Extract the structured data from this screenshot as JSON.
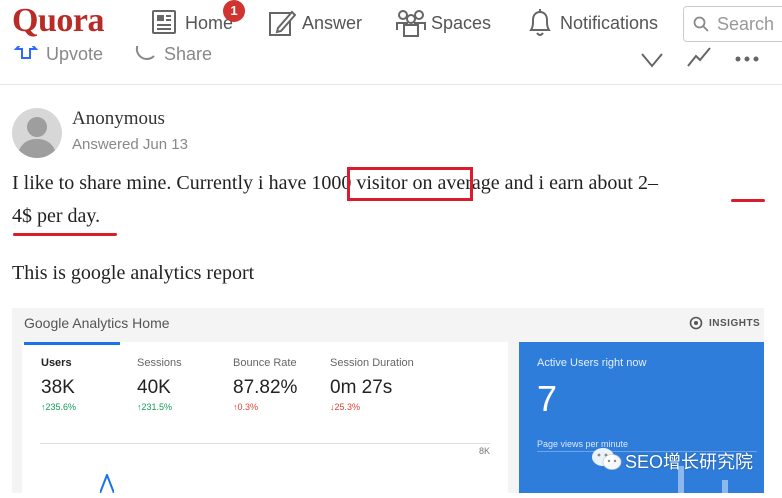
{
  "header": {
    "logo": "Quora",
    "nav": [
      {
        "label": "Home",
        "icon": "home-feed-icon"
      },
      {
        "label": "Answer",
        "icon": "pencil-icon"
      },
      {
        "label": "Spaces",
        "icon": "people-icon"
      },
      {
        "label": "Notifications",
        "icon": "bell-icon"
      }
    ],
    "home_badge": "1",
    "search_placeholder": "Search"
  },
  "action_bar": {
    "upvote": "Upvote",
    "share": "Share"
  },
  "answer": {
    "author": "Anonymous",
    "date": "Answered Jun 13",
    "line1_a": "I like to share mine. Currently i have",
    "line1_highlight": "1000 visitor",
    "line1_b": "on average and i earn about",
    "line1_c": "2–",
    "line2": "4$ per day.",
    "para2": "This is google analytics report"
  },
  "analytics": {
    "title": "Google Analytics Home",
    "insights": "INSIGHTS",
    "metrics": [
      {
        "label": "Users",
        "value": "38K",
        "change": "235.6%",
        "direction": "up"
      },
      {
        "label": "Sessions",
        "value": "40K",
        "change": "231.5%",
        "direction": "up"
      },
      {
        "label": "Bounce Rate",
        "value": "87.82%",
        "change": "0.3%",
        "direction": "up"
      },
      {
        "label": "Session Duration",
        "value": "0m 27s",
        "change": "25.3%",
        "direction": "down"
      }
    ],
    "chart_tick": "8K",
    "active_users_label": "Active Users right now",
    "active_users_value": "7",
    "page_views_label": "Page views per minute"
  },
  "watermark": "SEO增长研究院",
  "colors": {
    "brand": "#b92b27",
    "highlight": "#d81e2b",
    "ga_blue": "#2e7ddb",
    "positive": "#0f9d58",
    "negative": "#db4437"
  }
}
